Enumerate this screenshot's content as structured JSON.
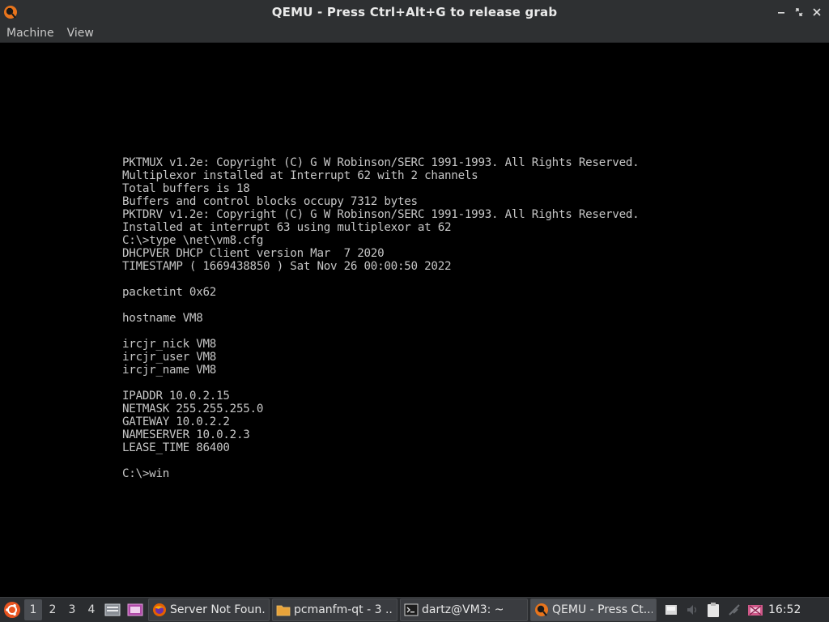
{
  "window": {
    "title": "QEMU - Press Ctrl+Alt+G to release grab",
    "app_icon": "qemu-icon",
    "controls": {
      "minimize": "minimize-icon",
      "maximize": "maximize-icon",
      "close": "close-icon"
    }
  },
  "menubar": {
    "items": [
      {
        "label": "Machine"
      },
      {
        "label": "View"
      }
    ]
  },
  "console": {
    "lines": [
      "PKTMUX v1.2e: Copyright (C) G W Robinson/SERC 1991-1993. All Rights Reserved.",
      "Multiplexor installed at Interrupt 62 with 2 channels",
      "Total buffers is 18",
      "Buffers and control blocks occupy 7312 bytes",
      "PKTDRV v1.2e: Copyright (C) G W Robinson/SERC 1991-1993. All Rights Reserved.",
      "Installed at interrupt 63 using multiplexor at 62",
      "C:\\>type \\net\\vm8.cfg",
      "DHCPVER DHCP Client version Mar  7 2020",
      "TIMESTAMP ( 1669438850 ) Sat Nov 26 00:00:50 2022",
      "",
      "packetint 0x62",
      "",
      "hostname VM8",
      "",
      "ircjr_nick VM8",
      "ircjr_user VM8",
      "ircjr_name VM8",
      "",
      "IPADDR 10.0.2.15",
      "NETMASK 255.255.255.0",
      "GATEWAY 10.0.2.2",
      "NAMESERVER 10.0.2.3",
      "LEASE_TIME 86400",
      "",
      "C:\\>win"
    ]
  },
  "taskbar": {
    "start_icon": "ubuntu-logo-icon",
    "desktops": [
      "1",
      "2",
      "3",
      "4"
    ],
    "active_desktop": "1",
    "launchers": [
      "file-manager-icon",
      "screenshot-icon"
    ],
    "tasks": [
      {
        "label": "Server Not Foun...",
        "icon": "firefox-icon"
      },
      {
        "label": "pcmanfm-qt - 3 ...",
        "icon": "folder-icon"
      },
      {
        "label": "dartz@VM3: ~",
        "icon": "terminal-icon"
      },
      {
        "label": "QEMU - Press Ct...",
        "icon": "qemu-icon"
      }
    ],
    "tray": [
      "removable-media-icon",
      "volume-icon",
      "clipboard-icon",
      "network-icon",
      "battery-icon"
    ],
    "clock": "16:52"
  },
  "colors": {
    "titlebar_bg": "#2e3032",
    "console_text": "#c6c6c6",
    "console_bg": "#000000",
    "taskbar_bg": "#2b2d30",
    "qemu_orange": "#e8741c"
  }
}
